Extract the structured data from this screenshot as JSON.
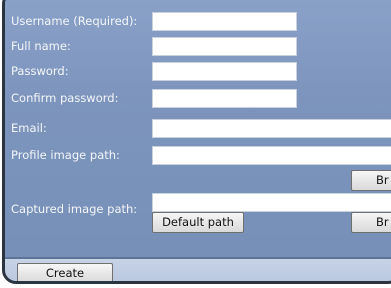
{
  "form": {
    "username_label": "Username (Required):",
    "username_value": "",
    "fullname_label": "Full name:",
    "fullname_value": "",
    "password_label": "Password:",
    "password_value": "",
    "confirm_label": "Confirm password:",
    "confirm_value": "",
    "email_label": "Email:",
    "email_value": "",
    "profile_label": "Profile image path:",
    "profile_value": "",
    "profile_browse_label": "Br",
    "captured_label": "Captured image path:",
    "captured_value": "",
    "default_path_label": "Default path",
    "captured_browse_label": "Br"
  },
  "footer": {
    "create_label": "Create"
  }
}
